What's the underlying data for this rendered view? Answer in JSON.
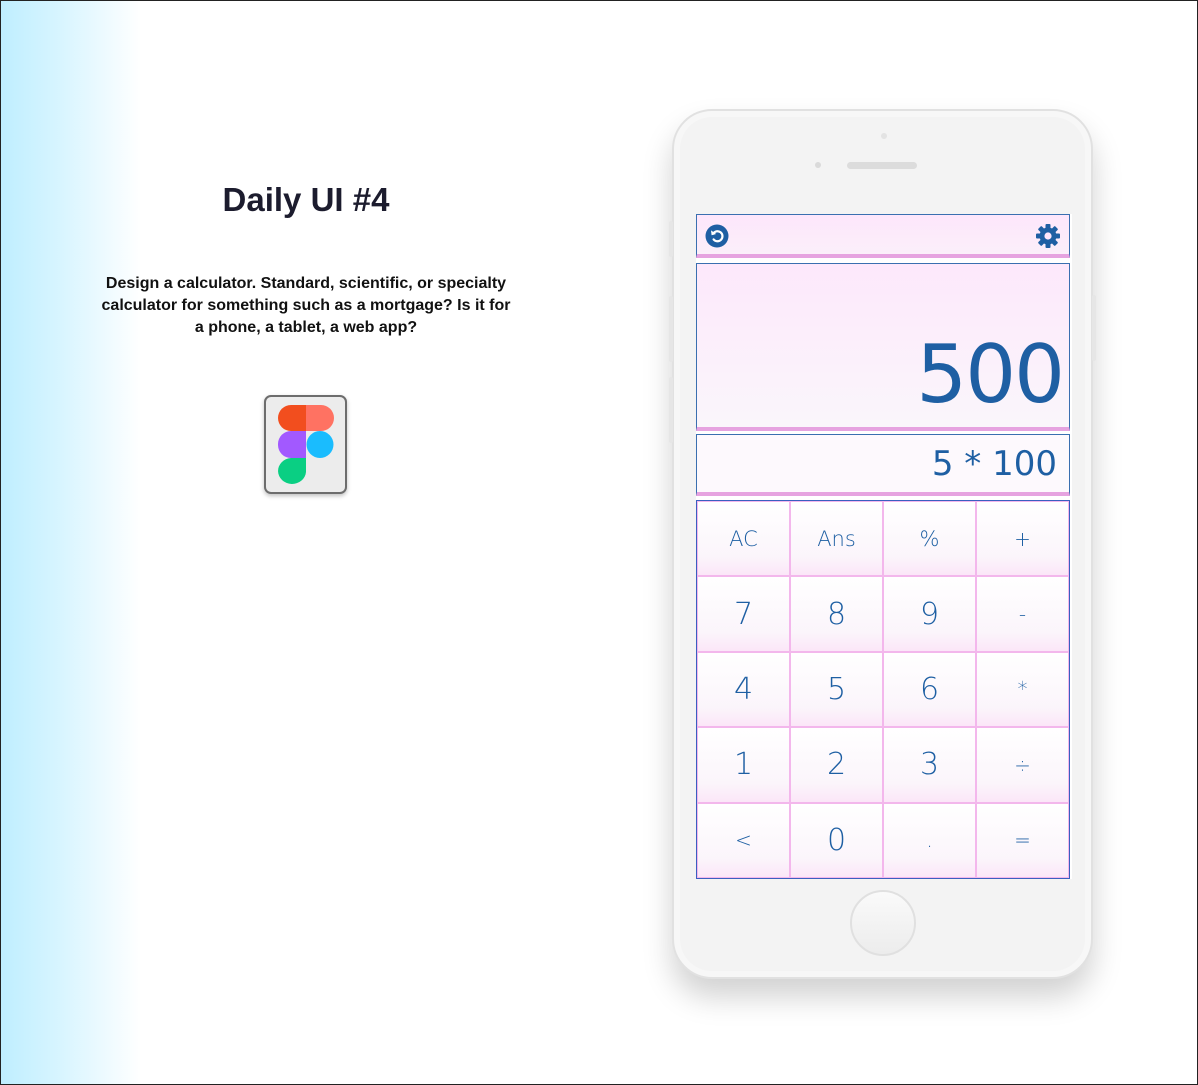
{
  "page": {
    "title": "Daily UI #4",
    "description": "Design a calculator. Standard, scientific, or specialty calculator for something such as a mortgage? Is it for a phone, a tablet, a web app?",
    "tool_icon": "figma-icon"
  },
  "calculator": {
    "undo_icon": "undo-icon",
    "settings_icon": "gear-icon",
    "result": "500",
    "expression": "5 * 100",
    "keys": [
      [
        "AC",
        "Ans",
        "%",
        "+"
      ],
      [
        "7",
        "8",
        "9",
        "-"
      ],
      [
        "4",
        "5",
        "6",
        "*"
      ],
      [
        "1",
        "2",
        "3",
        "÷"
      ],
      [
        "<",
        "0",
        ".",
        "="
      ]
    ]
  },
  "colors": {
    "accent": "#1e5fa3",
    "key_border": "#f3b7ec",
    "display_bg": "#fde8fb",
    "title": "#1c1c2e"
  }
}
